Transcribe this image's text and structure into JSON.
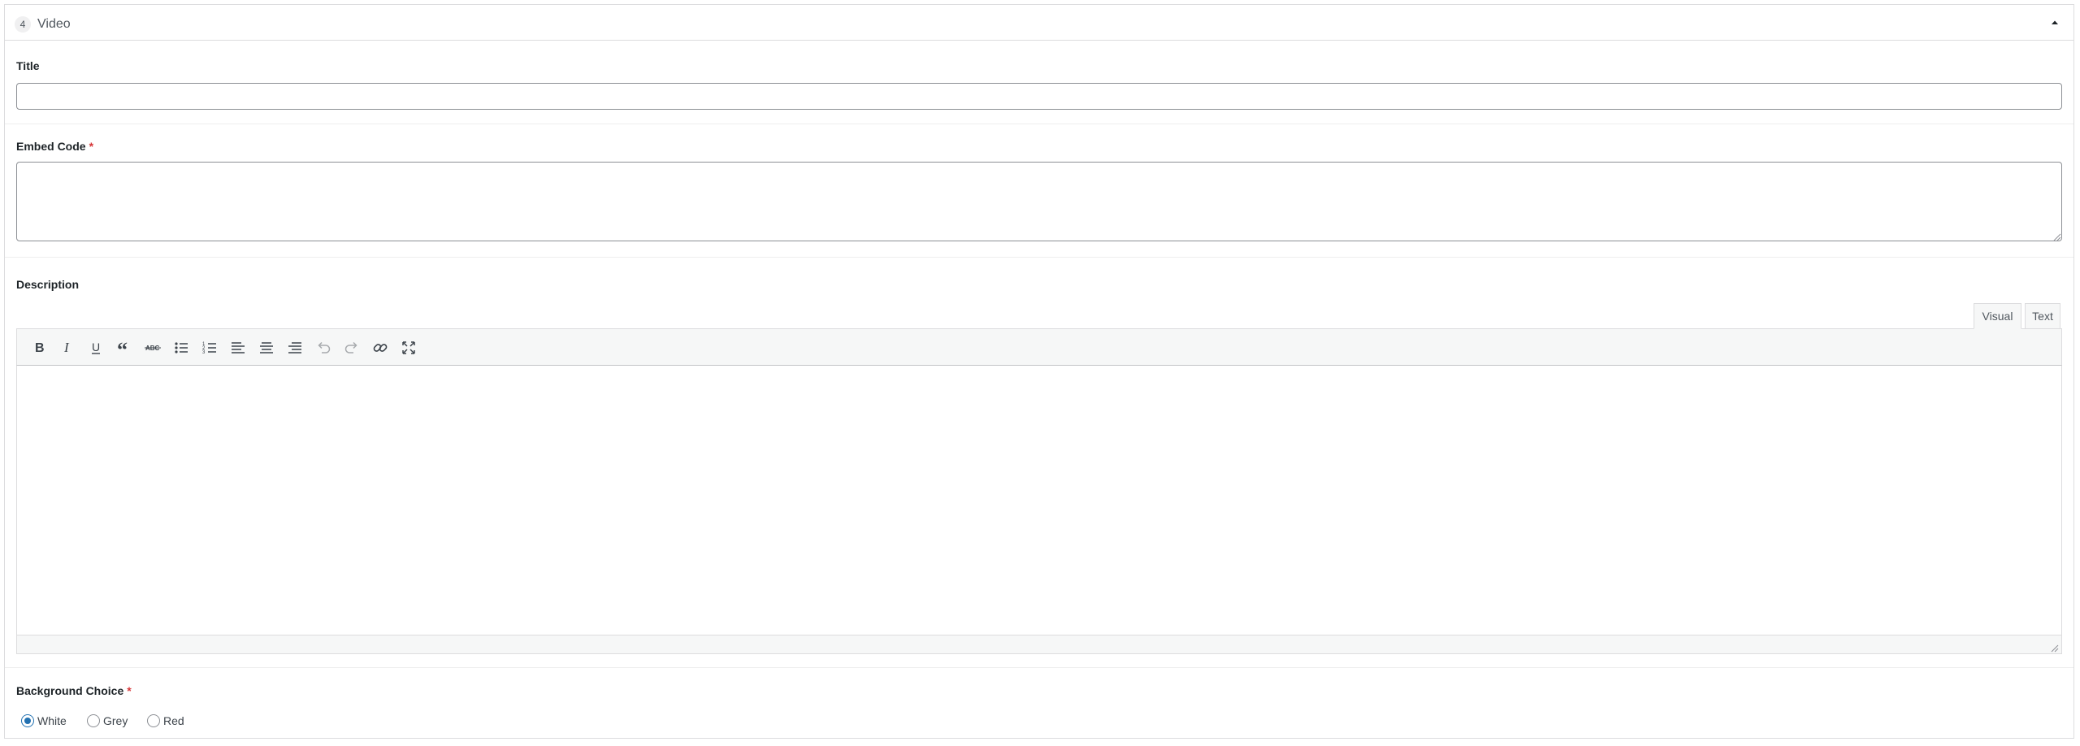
{
  "layout": {
    "order": "4",
    "name": "Video",
    "collapse_icon": "caret-up-icon"
  },
  "fields": {
    "title": {
      "label": "Title",
      "value": ""
    },
    "embed_code": {
      "label": "Embed Code",
      "required_mark": "*",
      "value": ""
    },
    "description": {
      "label": "Description",
      "tabs": [
        "Visual",
        "Text"
      ],
      "active_tab": "Visual",
      "toolbar": [
        {
          "name": "bold-icon",
          "label": "B"
        },
        {
          "name": "italic-icon",
          "label": "I"
        },
        {
          "name": "underline-icon",
          "label": "U"
        },
        {
          "name": "blockquote-icon",
          "label": "quote"
        },
        {
          "name": "strikethrough-icon",
          "label": "ABC"
        },
        {
          "name": "bulleted-list-icon",
          "label": "ul"
        },
        {
          "name": "numbered-list-icon",
          "label": "ol"
        },
        {
          "name": "align-left-icon",
          "label": "left"
        },
        {
          "name": "align-center-icon",
          "label": "center"
        },
        {
          "name": "align-right-icon",
          "label": "right"
        },
        {
          "name": "undo-icon",
          "label": "undo"
        },
        {
          "name": "redo-icon",
          "label": "redo"
        },
        {
          "name": "link-icon",
          "label": "link"
        },
        {
          "name": "fullscreen-icon",
          "label": "fullscreen"
        }
      ],
      "content": ""
    },
    "background_choice": {
      "label": "Background Choice",
      "required_mark": "*",
      "options": [
        "White",
        "Grey",
        "Red"
      ],
      "selected": "White"
    }
  },
  "colors": {
    "required": "#d63638",
    "accent": "#2271b1",
    "border": "#dcdcde"
  }
}
